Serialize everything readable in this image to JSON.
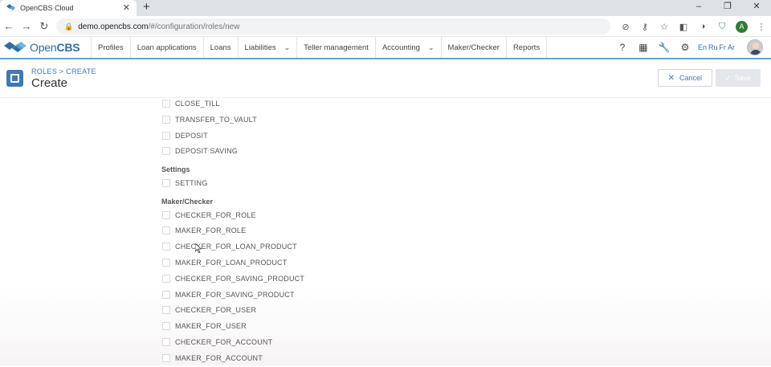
{
  "browser": {
    "tab_title": "OpenCBS Cloud",
    "url_host": "demo.opencbs.com",
    "url_path": "/#/configuration/roles/new",
    "profile_initial": "A"
  },
  "nav": {
    "logo_text_light": "Open",
    "logo_text_bold": "CBS",
    "items": [
      {
        "label": "Profiles"
      },
      {
        "label": "Loan applications"
      },
      {
        "label": "Loans"
      },
      {
        "label": "Liabilities",
        "caret": true
      },
      {
        "label": "Teller management"
      },
      {
        "label": "Accounting",
        "caret": true
      },
      {
        "label": "Maker/Checker"
      },
      {
        "label": "Reports"
      }
    ],
    "languages": [
      "En",
      "Ru",
      "Fr",
      "Ar"
    ]
  },
  "header": {
    "breadcrumb": "ROLES > CREATE",
    "title": "Create",
    "cancel_label": "Cancel",
    "save_label": "Save"
  },
  "permissions": [
    {
      "type": "item",
      "label": "CLOSE_TILL"
    },
    {
      "type": "item",
      "label": "TRANSFER_TO_VAULT"
    },
    {
      "type": "item",
      "label": "DEPOSIT"
    },
    {
      "type": "item",
      "label": "DEPOSIT SAVING"
    },
    {
      "type": "group",
      "label": "Settings"
    },
    {
      "type": "item",
      "label": "SETTING"
    },
    {
      "type": "group",
      "label": "Maker/Checker"
    },
    {
      "type": "item",
      "label": "CHECKER_FOR_ROLE"
    },
    {
      "type": "item",
      "label": "MAKER_FOR_ROLE"
    },
    {
      "type": "item",
      "label": "CHECKER_FOR_LOAN_PRODUCT"
    },
    {
      "type": "item",
      "label": "MAKER_FOR_LOAN_PRODUCT"
    },
    {
      "type": "item",
      "label": "CHECKER_FOR_SAVING_PRODUCT"
    },
    {
      "type": "item",
      "label": "MAKER_FOR_SAVING_PRODUCT"
    },
    {
      "type": "item",
      "label": "CHECKER_FOR_USER"
    },
    {
      "type": "item",
      "label": "MAKER_FOR_USER"
    },
    {
      "type": "item",
      "label": "CHECKER_FOR_ACCOUNT"
    },
    {
      "type": "item",
      "label": "MAKER_FOR_ACCOUNT"
    }
  ],
  "colors": {
    "brand": "#2d6fa7",
    "accent_line": "#5aa9d6",
    "save_disabled": "#e3e6ea"
  }
}
